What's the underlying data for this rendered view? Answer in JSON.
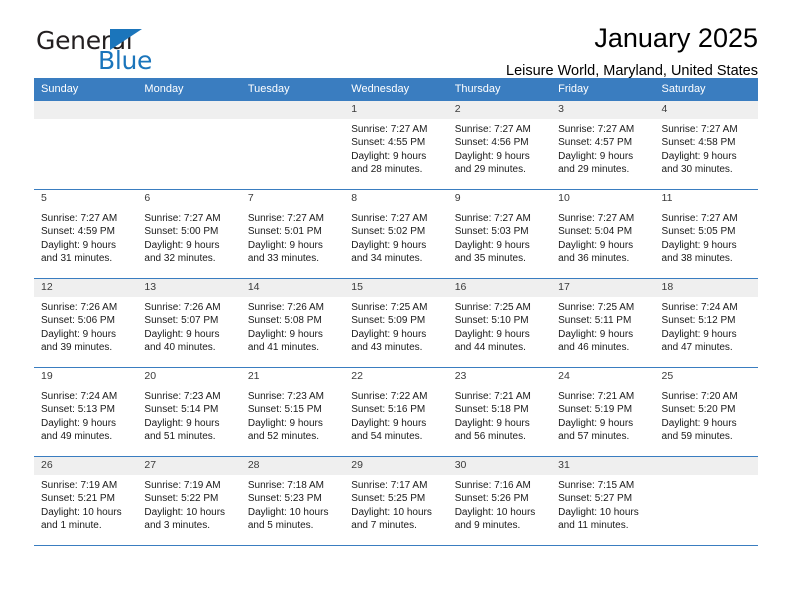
{
  "brand": {
    "word_general": "General",
    "word_blue": "Blue",
    "triangle_color": "#1b75bb"
  },
  "header": {
    "title": "January 2025",
    "subtitle": "Leisure World, Maryland, United States"
  },
  "theme": {
    "header_row_bg": "#3a7dc0",
    "header_row_text": "#ffffff",
    "shaded_cell_bg": "#efefef",
    "grid_line": "#3a7dc0"
  },
  "labels": {
    "sunrise_prefix": "Sunrise:",
    "sunset_prefix": "Sunset:",
    "daylight_prefix": "Daylight:"
  },
  "weekdays": [
    "Sunday",
    "Monday",
    "Tuesday",
    "Wednesday",
    "Thursday",
    "Friday",
    "Saturday"
  ],
  "weeks": [
    [
      {
        "day": "",
        "empty": true,
        "sunrise": "",
        "sunset": "",
        "daylight1": "",
        "daylight2": ""
      },
      {
        "day": "",
        "empty": true,
        "sunrise": "",
        "sunset": "",
        "daylight1": "",
        "daylight2": ""
      },
      {
        "day": "",
        "empty": true,
        "sunrise": "",
        "sunset": "",
        "daylight1": "",
        "daylight2": ""
      },
      {
        "day": "1",
        "sunrise": "Sunrise: 7:27 AM",
        "sunset": "Sunset: 4:55 PM",
        "daylight1": "Daylight: 9 hours",
        "daylight2": "and 28 minutes."
      },
      {
        "day": "2",
        "sunrise": "Sunrise: 7:27 AM",
        "sunset": "Sunset: 4:56 PM",
        "daylight1": "Daylight: 9 hours",
        "daylight2": "and 29 minutes."
      },
      {
        "day": "3",
        "sunrise": "Sunrise: 7:27 AM",
        "sunset": "Sunset: 4:57 PM",
        "daylight1": "Daylight: 9 hours",
        "daylight2": "and 29 minutes."
      },
      {
        "day": "4",
        "sunrise": "Sunrise: 7:27 AM",
        "sunset": "Sunset: 4:58 PM",
        "daylight1": "Daylight: 9 hours",
        "daylight2": "and 30 minutes."
      }
    ],
    [
      {
        "day": "5",
        "sunrise": "Sunrise: 7:27 AM",
        "sunset": "Sunset: 4:59 PM",
        "daylight1": "Daylight: 9 hours",
        "daylight2": "and 31 minutes."
      },
      {
        "day": "6",
        "sunrise": "Sunrise: 7:27 AM",
        "sunset": "Sunset: 5:00 PM",
        "daylight1": "Daylight: 9 hours",
        "daylight2": "and 32 minutes."
      },
      {
        "day": "7",
        "sunrise": "Sunrise: 7:27 AM",
        "sunset": "Sunset: 5:01 PM",
        "daylight1": "Daylight: 9 hours",
        "daylight2": "and 33 minutes."
      },
      {
        "day": "8",
        "sunrise": "Sunrise: 7:27 AM",
        "sunset": "Sunset: 5:02 PM",
        "daylight1": "Daylight: 9 hours",
        "daylight2": "and 34 minutes."
      },
      {
        "day": "9",
        "sunrise": "Sunrise: 7:27 AM",
        "sunset": "Sunset: 5:03 PM",
        "daylight1": "Daylight: 9 hours",
        "daylight2": "and 35 minutes."
      },
      {
        "day": "10",
        "sunrise": "Sunrise: 7:27 AM",
        "sunset": "Sunset: 5:04 PM",
        "daylight1": "Daylight: 9 hours",
        "daylight2": "and 36 minutes."
      },
      {
        "day": "11",
        "sunrise": "Sunrise: 7:27 AM",
        "sunset": "Sunset: 5:05 PM",
        "daylight1": "Daylight: 9 hours",
        "daylight2": "and 38 minutes."
      }
    ],
    [
      {
        "day": "12",
        "sunrise": "Sunrise: 7:26 AM",
        "sunset": "Sunset: 5:06 PM",
        "daylight1": "Daylight: 9 hours",
        "daylight2": "and 39 minutes."
      },
      {
        "day": "13",
        "sunrise": "Sunrise: 7:26 AM",
        "sunset": "Sunset: 5:07 PM",
        "daylight1": "Daylight: 9 hours",
        "daylight2": "and 40 minutes."
      },
      {
        "day": "14",
        "sunrise": "Sunrise: 7:26 AM",
        "sunset": "Sunset: 5:08 PM",
        "daylight1": "Daylight: 9 hours",
        "daylight2": "and 41 minutes."
      },
      {
        "day": "15",
        "sunrise": "Sunrise: 7:25 AM",
        "sunset": "Sunset: 5:09 PM",
        "daylight1": "Daylight: 9 hours",
        "daylight2": "and 43 minutes."
      },
      {
        "day": "16",
        "sunrise": "Sunrise: 7:25 AM",
        "sunset": "Sunset: 5:10 PM",
        "daylight1": "Daylight: 9 hours",
        "daylight2": "and 44 minutes."
      },
      {
        "day": "17",
        "sunrise": "Sunrise: 7:25 AM",
        "sunset": "Sunset: 5:11 PM",
        "daylight1": "Daylight: 9 hours",
        "daylight2": "and 46 minutes."
      },
      {
        "day": "18",
        "sunrise": "Sunrise: 7:24 AM",
        "sunset": "Sunset: 5:12 PM",
        "daylight1": "Daylight: 9 hours",
        "daylight2": "and 47 minutes."
      }
    ],
    [
      {
        "day": "19",
        "sunrise": "Sunrise: 7:24 AM",
        "sunset": "Sunset: 5:13 PM",
        "daylight1": "Daylight: 9 hours",
        "daylight2": "and 49 minutes."
      },
      {
        "day": "20",
        "sunrise": "Sunrise: 7:23 AM",
        "sunset": "Sunset: 5:14 PM",
        "daylight1": "Daylight: 9 hours",
        "daylight2": "and 51 minutes."
      },
      {
        "day": "21",
        "sunrise": "Sunrise: 7:23 AM",
        "sunset": "Sunset: 5:15 PM",
        "daylight1": "Daylight: 9 hours",
        "daylight2": "and 52 minutes."
      },
      {
        "day": "22",
        "sunrise": "Sunrise: 7:22 AM",
        "sunset": "Sunset: 5:16 PM",
        "daylight1": "Daylight: 9 hours",
        "daylight2": "and 54 minutes."
      },
      {
        "day": "23",
        "sunrise": "Sunrise: 7:21 AM",
        "sunset": "Sunset: 5:18 PM",
        "daylight1": "Daylight: 9 hours",
        "daylight2": "and 56 minutes."
      },
      {
        "day": "24",
        "sunrise": "Sunrise: 7:21 AM",
        "sunset": "Sunset: 5:19 PM",
        "daylight1": "Daylight: 9 hours",
        "daylight2": "and 57 minutes."
      },
      {
        "day": "25",
        "sunrise": "Sunrise: 7:20 AM",
        "sunset": "Sunset: 5:20 PM",
        "daylight1": "Daylight: 9 hours",
        "daylight2": "and 59 minutes."
      }
    ],
    [
      {
        "day": "26",
        "sunrise": "Sunrise: 7:19 AM",
        "sunset": "Sunset: 5:21 PM",
        "daylight1": "Daylight: 10 hours",
        "daylight2": "and 1 minute."
      },
      {
        "day": "27",
        "sunrise": "Sunrise: 7:19 AM",
        "sunset": "Sunset: 5:22 PM",
        "daylight1": "Daylight: 10 hours",
        "daylight2": "and 3 minutes."
      },
      {
        "day": "28",
        "sunrise": "Sunrise: 7:18 AM",
        "sunset": "Sunset: 5:23 PM",
        "daylight1": "Daylight: 10 hours",
        "daylight2": "and 5 minutes."
      },
      {
        "day": "29",
        "sunrise": "Sunrise: 7:17 AM",
        "sunset": "Sunset: 5:25 PM",
        "daylight1": "Daylight: 10 hours",
        "daylight2": "and 7 minutes."
      },
      {
        "day": "30",
        "sunrise": "Sunrise: 7:16 AM",
        "sunset": "Sunset: 5:26 PM",
        "daylight1": "Daylight: 10 hours",
        "daylight2": "and 9 minutes."
      },
      {
        "day": "31",
        "sunrise": "Sunrise: 7:15 AM",
        "sunset": "Sunset: 5:27 PM",
        "daylight1": "Daylight: 10 hours",
        "daylight2": "and 11 minutes."
      },
      {
        "day": "",
        "empty": true,
        "sunrise": "",
        "sunset": "",
        "daylight1": "",
        "daylight2": ""
      }
    ]
  ]
}
